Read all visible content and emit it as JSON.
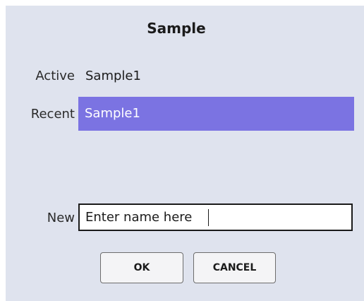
{
  "dialog": {
    "title": "Sample",
    "active_label": "Active",
    "active_value": "Sample1",
    "recent_label": "Recent",
    "recent_items": [
      "Sample1"
    ],
    "new_label": "New",
    "new_placeholder": "Enter name here",
    "ok_label": "OK",
    "cancel_label": "CANCEL"
  },
  "colors": {
    "background": "#dfe3ee",
    "selected_item": "#7b73e2",
    "selected_text": "#ffffff"
  }
}
